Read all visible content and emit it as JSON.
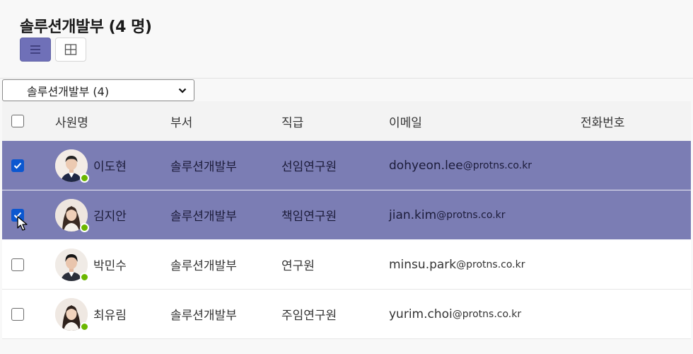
{
  "page": {
    "title": "솔루션개발부 (4 명)"
  },
  "view_toggle": {
    "list_icon": "list-icon",
    "grid_icon": "grid-icon",
    "active": "list"
  },
  "filter": {
    "selected": "솔루션개발부 (4)",
    "icon": "chevron-down-icon"
  },
  "table": {
    "headers": {
      "name": "사원명",
      "dept": "부서",
      "rank": "직급",
      "email": "이메일",
      "phone": "전화번호"
    },
    "rows": [
      {
        "checked": true,
        "name": "이도현",
        "dept": "솔루션개발부",
        "rank": "선임연구원",
        "email_user": "dohyeon.lee",
        "email_domain": "@protns.co.kr",
        "phone": "",
        "avatar": "male-avatar",
        "status": "available"
      },
      {
        "checked": true,
        "name": "김지안",
        "dept": "솔루션개발부",
        "rank": "책임연구원",
        "email_user": "jian.kim",
        "email_domain": "@protns.co.kr",
        "phone": "",
        "avatar": "female-avatar",
        "status": "available"
      },
      {
        "checked": false,
        "name": "박민수",
        "dept": "솔루션개발부",
        "rank": "연구원",
        "email_user": "minsu.park",
        "email_domain": "@protns.co.kr",
        "phone": "",
        "avatar": "male-avatar",
        "status": "available"
      },
      {
        "checked": false,
        "name": "최유림",
        "dept": "솔루션개발부",
        "rank": "주임연구원",
        "email_user": "yurim.choi",
        "email_domain": "@protns.co.kr",
        "phone": "",
        "avatar": "female-avatar",
        "status": "available"
      }
    ]
  },
  "colors": {
    "selected_row": "#7b7db4",
    "active_toggle": "#6f70b8",
    "status_available": "#6bb700",
    "checkbox_checked": "#0b57d0"
  }
}
